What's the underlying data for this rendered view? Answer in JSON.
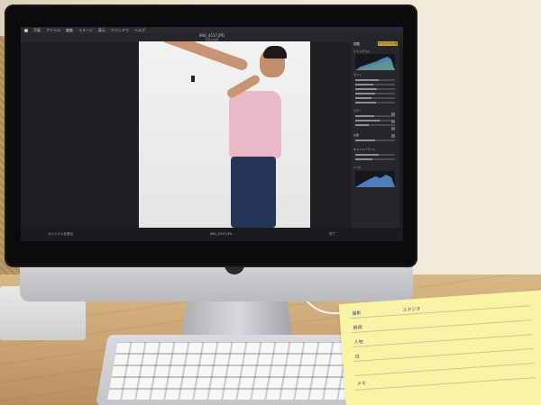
{
  "menubar": {
    "apple": "",
    "items": [
      "写真",
      "ファイル",
      "編集",
      "イメージ",
      "表示",
      "ウインドウ",
      "ヘルプ"
    ]
  },
  "window": {
    "title": "IMG_4517.JPG",
    "subtitle": "写真を編集"
  },
  "panel": {
    "title": "調整",
    "export_label": "オリジナルに戻す",
    "sections": [
      "ヒストグラム",
      "ライト",
      "カラー",
      "白黒",
      "ホワイトバランス",
      "レベル"
    ]
  },
  "bottom_bar": {
    "left": "オリジナルを表示",
    "center": "IMG_4517.JPG",
    "right": "完了"
  },
  "note": {
    "lines": [
      "撮影",
      "スタジオ",
      "照明",
      "人物",
      "白",
      "メモ"
    ]
  },
  "colors": {
    "bezel": "#0b0b0d",
    "accent": "#c9a33b",
    "note": "#faf3a4",
    "shirt": "#e8b9c6",
    "pants": "#243457"
  }
}
